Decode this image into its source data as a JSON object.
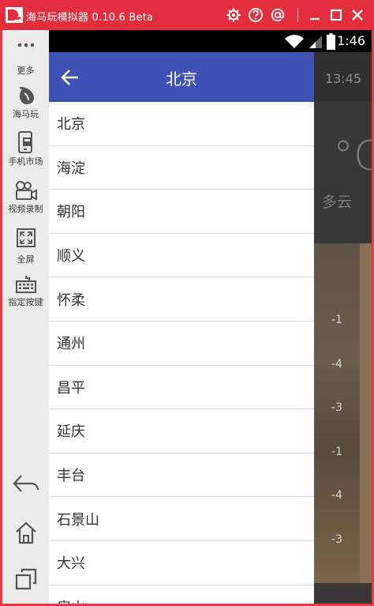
{
  "window": {
    "title": "海马玩模拟器 0.10.6 Beta"
  },
  "titlebar_icons": [
    "gear-icon",
    "help-icon",
    "at-icon",
    "minimize-icon",
    "maximize-icon",
    "close-icon"
  ],
  "sidebar": {
    "items": [
      {
        "label": "更多",
        "icon": "more-dots-icon"
      },
      {
        "label": "海马玩",
        "icon": "haimawan-logo-icon"
      },
      {
        "label": "手机市场",
        "icon": "phone-market-icon"
      },
      {
        "label": "视频录制",
        "icon": "video-camera-icon"
      },
      {
        "label": "全屏",
        "icon": "fullscreen-icon"
      },
      {
        "label": "指定按键",
        "icon": "keyboard-icon"
      }
    ],
    "nav": [
      "back-icon",
      "home-icon",
      "recent-apps-icon"
    ]
  },
  "statusbar": {
    "time": "1:46"
  },
  "background_app": {
    "time": "13:45",
    "temperature": "°C",
    "condition": "多云",
    "values": [
      "-1",
      "-4",
      "-3",
      "-1",
      "-4",
      "-3"
    ]
  },
  "drawer": {
    "title": "北京",
    "districts": [
      "北京",
      "海淀",
      "朝阳",
      "顺义",
      "怀柔",
      "通州",
      "昌平",
      "延庆",
      "丰台",
      "石景山",
      "大兴",
      "房山"
    ]
  },
  "colors": {
    "titlebar": "#e32f3d",
    "appbar": "#3f51b5",
    "sidebar": "#ecebe9"
  }
}
